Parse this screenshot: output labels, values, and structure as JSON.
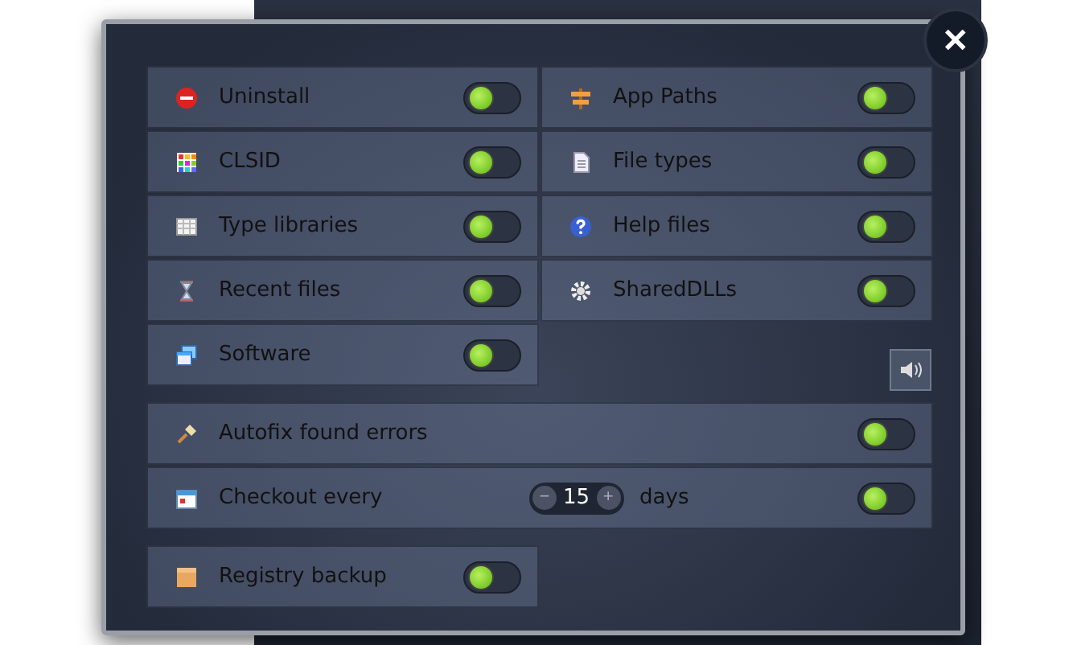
{
  "close_button": {
    "label": "✕"
  },
  "options": [
    {
      "label": "Uninstall",
      "lit": true
    },
    {
      "label": "App Paths",
      "lit": true
    },
    {
      "label": "CLSID",
      "lit": true
    },
    {
      "label": "File types",
      "lit": true
    },
    {
      "label": "Type libraries",
      "lit": true
    },
    {
      "label": "Help files",
      "lit": true
    },
    {
      "label": "Recent files",
      "lit": true
    },
    {
      "label": "SharedDLLs",
      "lit": true
    },
    {
      "label": "Software",
      "lit": true
    }
  ],
  "autofix": {
    "label": "Autofix found errors",
    "lit": true
  },
  "checkout": {
    "label": "Checkout every",
    "value": "15",
    "unit": "days",
    "decrement": "−",
    "increment": "+",
    "lit": true
  },
  "backup": {
    "label": "Registry backup",
    "lit": true
  }
}
